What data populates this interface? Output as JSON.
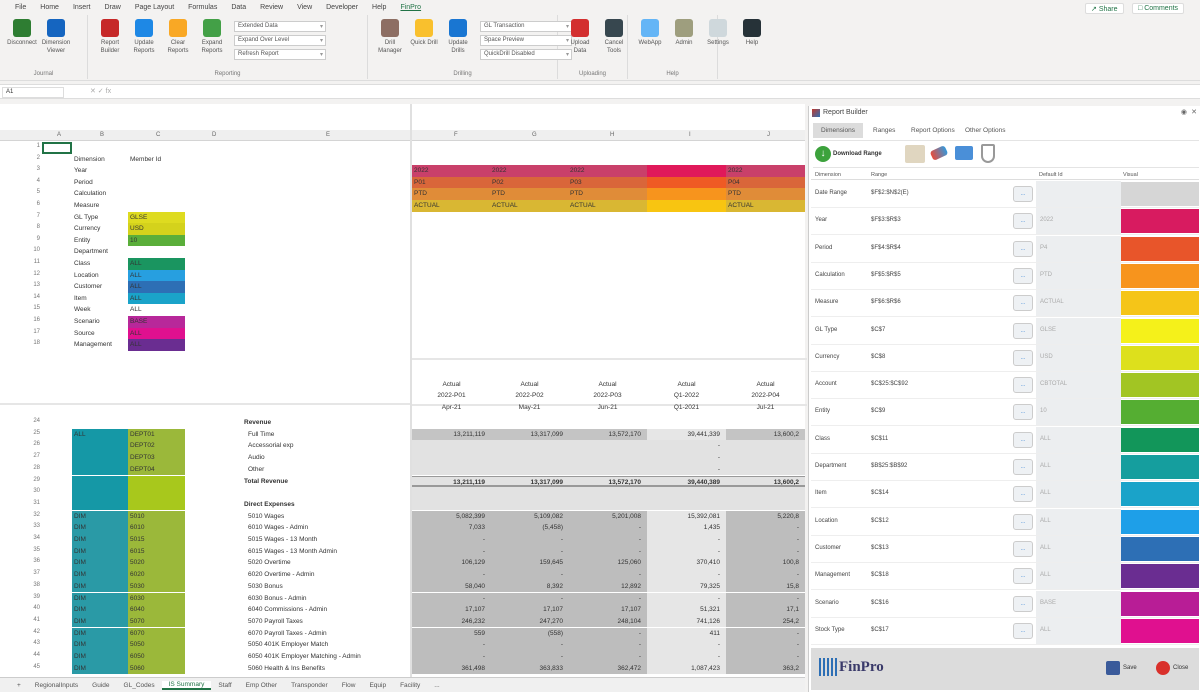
{
  "menu": {
    "tabs": [
      "File",
      "Home",
      "Insert",
      "Draw",
      "Page Layout",
      "Formulas",
      "Data",
      "Review",
      "View",
      "Developer",
      "Help",
      "FinPro"
    ],
    "active": "FinPro",
    "share": "Share",
    "comments": "Comments"
  },
  "ribbon": {
    "groups": [
      {
        "label": "Journal",
        "buttons": [
          "Disconnect",
          "Dimension Viewer"
        ]
      },
      {
        "label": "Reporting",
        "buttons": [
          "Report Builder",
          "Update Reports",
          "Clear Reports",
          "Expand Reports"
        ],
        "dropdowns": [
          "Extended Data",
          "Expand Over Level",
          "Refresh Report"
        ]
      },
      {
        "label": "Drilling",
        "buttons": [
          "Drill Manager",
          "Quick Drill",
          "Update Drills"
        ],
        "dropdowns": [
          "GL Transaction",
          "Space Preview",
          "QuickDrill Disabled"
        ]
      },
      {
        "label": "Uploading",
        "buttons": [
          "Upload Data",
          "Cancel Tools"
        ]
      },
      {
        "label": "Help",
        "buttons": [
          "WebApp",
          "Admin",
          "Settings",
          "Help"
        ]
      }
    ]
  },
  "formula_bar": {
    "name_box": "A1",
    "value": ""
  },
  "sheet": {
    "left_columns": [
      "A",
      "B",
      "C",
      "D",
      "E"
    ],
    "right_columns": [
      "F",
      "G",
      "H",
      "I",
      "J"
    ],
    "dimension_header": "Dimension",
    "member_header": "Member Id",
    "dimensions": [
      {
        "row": 3,
        "label": "Year",
        "value": "",
        "color": ""
      },
      {
        "row": 4,
        "label": "Period",
        "value": "",
        "color": ""
      },
      {
        "row": 5,
        "label": "Calculation",
        "value": "",
        "color": ""
      },
      {
        "row": 6,
        "label": "Measure",
        "value": "",
        "color": ""
      },
      {
        "row": 7,
        "label": "GL Type",
        "value": "GLSE",
        "color": "#dedb20"
      },
      {
        "row": 8,
        "label": "Currency",
        "value": "USD",
        "color": "#d4d21c"
      },
      {
        "row": 9,
        "label": "Entity",
        "value": "10",
        "color": "#5aae3a"
      },
      {
        "row": 10,
        "label": "Department",
        "value": "",
        "color": ""
      },
      {
        "row": 11,
        "label": "Class",
        "value": "ALL",
        "color": "#1a9560"
      },
      {
        "row": 12,
        "label": "Location",
        "value": "ALL",
        "color": "#279fe0"
      },
      {
        "row": 13,
        "label": "Customer",
        "value": "ALL",
        "color": "#2d6fb5"
      },
      {
        "row": 14,
        "label": "Item",
        "value": "ALL",
        "color": "#1aa3c9"
      },
      {
        "row": 15,
        "label": "Week",
        "value": "ALL",
        "color": ""
      },
      {
        "row": 16,
        "label": "Scenario",
        "value": "BASE",
        "color": "#b8289a"
      },
      {
        "row": 17,
        "label": "Source",
        "value": "ALL",
        "color": "#e0108f"
      },
      {
        "row": 18,
        "label": "Management",
        "value": "ALL",
        "color": "#6a2d91"
      }
    ],
    "period_columns": [
      {
        "year": "2022",
        "period": "P01",
        "calc": "PTD",
        "measure": "ACTUAL",
        "h1": "Actual",
        "h2": "2022-P01",
        "h3": "Apr-21",
        "vivid": false
      },
      {
        "year": "2022",
        "period": "P02",
        "calc": "PTD",
        "measure": "ACTUAL",
        "h1": "Actual",
        "h2": "2022-P02",
        "h3": "May-21",
        "vivid": false
      },
      {
        "year": "2022",
        "period": "P03",
        "calc": "PTD",
        "measure": "ACTUAL",
        "h1": "Actual",
        "h2": "2022-P03",
        "h3": "Jun-21",
        "vivid": false
      },
      {
        "year": "",
        "period": "",
        "calc": "",
        "measure": "",
        "h1": "Actual",
        "h2": "Q1-2022",
        "h3": "Q1-2021",
        "vivid": true
      },
      {
        "year": "2022",
        "period": "P04",
        "calc": "PTD",
        "measure": "ACTUAL",
        "h1": "Actual",
        "h2": "2022-P04",
        "h3": "Jul-21",
        "vivid": false
      }
    ],
    "band_colors_muted": [
      "#c9406a",
      "#d9663a",
      "#e08c38",
      "#d9b733"
    ],
    "band_colors_vivid": [
      "#e0195a",
      "#ef5a24",
      "#f7941d",
      "#f8c511"
    ],
    "lines": [
      {
        "row": 24,
        "a": "",
        "c": "",
        "label": "Revenue",
        "bold": true,
        "values": [
          "",
          "",
          "",
          "",
          ""
        ],
        "shade": "none"
      },
      {
        "row": 25,
        "a": "ALL",
        "c": "DEPT01",
        "label": "Full Time",
        "bold": false,
        "values": [
          "13,211,119",
          "13,317,099",
          "13,572,170",
          "39,441,339",
          "13,600,2"
        ],
        "shade": "dark"
      },
      {
        "row": 26,
        "a": "",
        "c": "DEPT02",
        "label": "Accessorial exp",
        "bold": false,
        "values": [
          "",
          "",
          "",
          "-",
          ""
        ],
        "shade": "light"
      },
      {
        "row": 27,
        "a": "",
        "c": "DEPT03",
        "label": "Audio",
        "bold": false,
        "values": [
          "",
          "",
          "",
          "-",
          ""
        ],
        "shade": "light"
      },
      {
        "row": 28,
        "a": "",
        "c": "DEPT04",
        "label": "Other",
        "bold": false,
        "values": [
          "",
          "",
          "",
          "-",
          ""
        ],
        "shade": "light"
      },
      {
        "row": 29,
        "a": "",
        "c": "",
        "label": "Total Revenue",
        "bold": true,
        "values": [
          "13,211,119",
          "13,317,099",
          "13,572,170",
          "39,440,389",
          "13,600,2"
        ],
        "shade": "total"
      },
      {
        "row": 30,
        "a": "",
        "c": "",
        "label": "",
        "bold": false,
        "values": [
          "",
          "",
          "",
          "",
          ""
        ],
        "shade": "light"
      },
      {
        "row": 31,
        "a": "",
        "c": "",
        "label": "Direct Expenses",
        "bold": true,
        "values": [
          "",
          "",
          "",
          "",
          ""
        ],
        "shade": "light"
      },
      {
        "row": 32,
        "a": "DIM",
        "c": "5010",
        "label": "5010 Wages",
        "bold": false,
        "values": [
          "5,082,399",
          "5,109,082",
          "5,201,008",
          "15,392,081",
          "5,220,8"
        ],
        "shade": "exp"
      },
      {
        "row": 33,
        "a": "DIM",
        "c": "6010",
        "label": "6010 Wages - Admin",
        "bold": false,
        "values": [
          "7,033",
          "(5,458)",
          "-",
          "1,435",
          "-"
        ],
        "shade": "exp"
      },
      {
        "row": 34,
        "a": "DIM",
        "c": "5015",
        "label": "5015 Wages - 13 Month",
        "bold": false,
        "values": [
          "-",
          "-",
          "-",
          "-",
          "-"
        ],
        "shade": "exp"
      },
      {
        "row": 35,
        "a": "DIM",
        "c": "6015",
        "label": "6015 Wages - 13 Month Admin",
        "bold": false,
        "values": [
          "-",
          "-",
          "-",
          "-",
          "-"
        ],
        "shade": "exp"
      },
      {
        "row": 36,
        "a": "DIM",
        "c": "5020",
        "label": "5020 Overtime",
        "bold": false,
        "values": [
          "106,129",
          "159,645",
          "125,060",
          "370,410",
          "100,8"
        ],
        "shade": "exp"
      },
      {
        "row": 37,
        "a": "DIM",
        "c": "6020",
        "label": "6020 Overtime - Admin",
        "bold": false,
        "values": [
          "-",
          "-",
          "-",
          "-",
          "-"
        ],
        "shade": "exp"
      },
      {
        "row": 38,
        "a": "DIM",
        "c": "5030",
        "label": "5030 Bonus",
        "bold": false,
        "values": [
          "58,040",
          "8,392",
          "12,892",
          "79,325",
          "15,8"
        ],
        "shade": "exp"
      },
      {
        "row": 39,
        "a": "DIM",
        "c": "6030",
        "label": "6030 Bonus - Admin",
        "bold": false,
        "values": [
          "-",
          "-",
          "-",
          "-",
          "-"
        ],
        "shade": "exp"
      },
      {
        "row": 40,
        "a": "DIM",
        "c": "6040",
        "label": "6040 Commissions - Admin",
        "bold": false,
        "values": [
          "17,107",
          "17,107",
          "17,107",
          "51,321",
          "17,1"
        ],
        "shade": "exp"
      },
      {
        "row": 41,
        "a": "DIM",
        "c": "5070",
        "label": "5070 Payroll Taxes",
        "bold": false,
        "values": [
          "246,232",
          "247,270",
          "248,104",
          "741,126",
          "254,2"
        ],
        "shade": "exp"
      },
      {
        "row": 42,
        "a": "DIM",
        "c": "6070",
        "label": "6070 Payroll Taxes - Admin",
        "bold": false,
        "values": [
          "559",
          "(558)",
          "-",
          "411",
          "-"
        ],
        "shade": "exp"
      },
      {
        "row": 43,
        "a": "DIM",
        "c": "5050",
        "label": "5050 401K Employer Match",
        "bold": false,
        "values": [
          "-",
          "-",
          "-",
          "-",
          "-"
        ],
        "shade": "exp"
      },
      {
        "row": 44,
        "a": "DIM",
        "c": "6050",
        "label": "6050 401K Employer Matching - Admin",
        "bold": false,
        "values": [
          "-",
          "-",
          "-",
          "-",
          "-"
        ],
        "shade": "exp"
      },
      {
        "row": 45,
        "a": "DIM",
        "c": "5060",
        "label": "5060 Health & Ins Benefits",
        "bold": false,
        "values": [
          "361,498",
          "363,833",
          "362,472",
          "1,087,423",
          "363,2"
        ],
        "shade": "exp"
      }
    ],
    "tabs": [
      "+",
      "RegionalInputs",
      "Guide",
      "GL_Codes",
      "IS Summary",
      "Staff",
      "Emp Other",
      "Transponder",
      "Flow",
      "Equip",
      "Facility",
      "..."
    ],
    "active_tab": "IS Summary"
  },
  "panel": {
    "title": "Report Builder",
    "tabs": [
      "Dimensions",
      "Ranges",
      "Report Options",
      "Other Options"
    ],
    "download_label": "Download Range",
    "headers": {
      "dimension": "Dimension",
      "range": "Range",
      "default": "Default Id",
      "visual": "Visual"
    },
    "rows": [
      {
        "dimension": "Date Range",
        "range": "$F$2:$N$2(E)",
        "default": "",
        "color": "#d6d6d6"
      },
      {
        "dimension": "Year",
        "range": "$F$3:$R$3",
        "default": "2022",
        "color": "#d81b60"
      },
      {
        "dimension": "Period",
        "range": "$F$4:$R$4",
        "default": "P4",
        "color": "#e8552a"
      },
      {
        "dimension": "Calculation",
        "range": "$F$5:$R$5",
        "default": "PTD",
        "color": "#f7941d"
      },
      {
        "dimension": "Measure",
        "range": "$F$6:$R$6",
        "default": "ACTUAL",
        "color": "#f5c518"
      },
      {
        "dimension": "GL Type",
        "range": "$C$7",
        "default": "GLSE",
        "color": "#f5f11a"
      },
      {
        "dimension": "Currency",
        "range": "$C$8",
        "default": "USD",
        "color": "#dde01c"
      },
      {
        "dimension": "Account",
        "range": "$C$25:$C$92",
        "default": "CBTOTAL",
        "color": "#a2c523"
      },
      {
        "dimension": "Entity",
        "range": "$C$9",
        "default": "10",
        "color": "#55ae32"
      },
      {
        "dimension": "Class",
        "range": "$C$11",
        "default": "ALL",
        "color": "#12965a"
      },
      {
        "dimension": "Department",
        "range": "$B$25:$B$92",
        "default": "ALL",
        "color": "#159e9e"
      },
      {
        "dimension": "Item",
        "range": "$C$14",
        "default": "ALL",
        "color": "#1aa3c9"
      },
      {
        "dimension": "Location",
        "range": "$C$12",
        "default": "ALL",
        "color": "#1e9fe8"
      },
      {
        "dimension": "Customer",
        "range": "$C$13",
        "default": "ALL",
        "color": "#2d6fb5"
      },
      {
        "dimension": "Management",
        "range": "$C$18",
        "default": "ALL",
        "color": "#6a2d91"
      },
      {
        "dimension": "Scenario",
        "range": "$C$16",
        "default": "BASE",
        "color": "#b81d96"
      },
      {
        "dimension": "Stock Type",
        "range": "$C$17",
        "default": "ALL",
        "color": "#e0108f"
      }
    ],
    "row_button": "...",
    "logo": "FinPro",
    "save_label": "Save",
    "close_label": "Close"
  }
}
